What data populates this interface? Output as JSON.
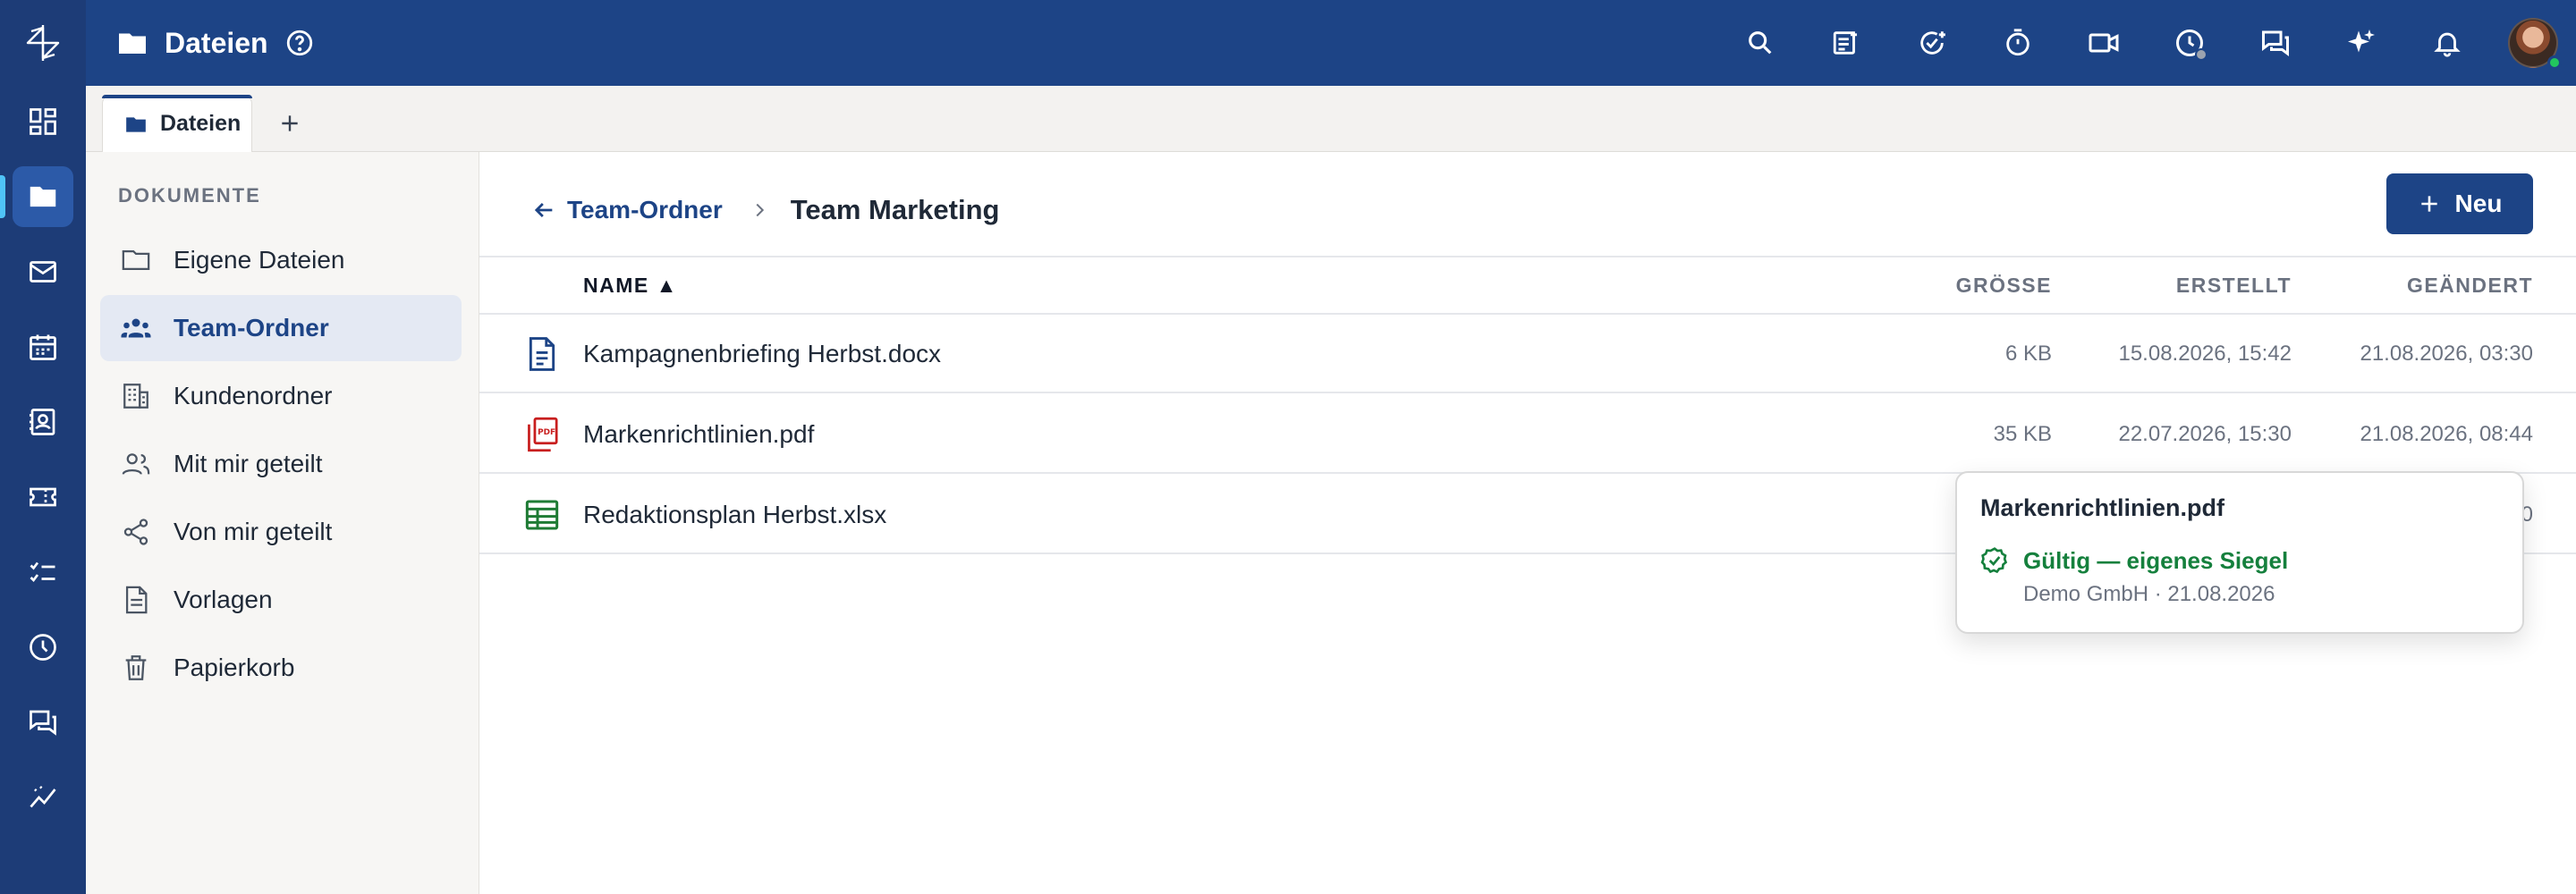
{
  "app": {
    "title": "Dateien"
  },
  "rail": {
    "items": [
      {
        "icon": "dashboard-icon"
      },
      {
        "icon": "folder-icon",
        "active": true
      },
      {
        "icon": "mail-icon"
      },
      {
        "icon": "calendar-icon"
      },
      {
        "icon": "contacts-icon"
      },
      {
        "icon": "ticket-icon"
      },
      {
        "icon": "tasks-icon"
      },
      {
        "icon": "clock-icon"
      },
      {
        "icon": "chat-icon"
      },
      {
        "icon": "analytics-icon"
      }
    ]
  },
  "topbar": {
    "icons": [
      "search-icon",
      "notes-icon",
      "task-add-icon",
      "timer-icon",
      "video-icon",
      "history-icon",
      "chat-icon",
      "ai-sparkle-icon",
      "bell-icon"
    ]
  },
  "tabs": [
    {
      "label": "Dateien"
    }
  ],
  "sidebar": {
    "section_title": "DOKUMENTE",
    "items": [
      {
        "label": "Eigene Dateien",
        "icon": "folder-outline-icon"
      },
      {
        "label": "Team-Ordner",
        "icon": "team-icon",
        "active": true
      },
      {
        "label": "Kundenordner",
        "icon": "building-icon"
      },
      {
        "label": "Mit mir geteilt",
        "icon": "people-icon"
      },
      {
        "label": "Von mir geteilt",
        "icon": "share-icon"
      },
      {
        "label": "Vorlagen",
        "icon": "template-icon"
      },
      {
        "label": "Papierkorb",
        "icon": "trash-icon"
      }
    ]
  },
  "breadcrumb": {
    "parent": "Team-Ordner",
    "current": "Team Marketing"
  },
  "actions": {
    "new_label": "Neu"
  },
  "table": {
    "columns": {
      "name": "NAME ▲",
      "size": "GRÖSSE",
      "created": "ERSTELLT",
      "modified": "GEÄNDERT"
    },
    "rows": [
      {
        "name": "Kampagnenbriefing Herbst.docx",
        "type": "docx",
        "size": "6 KB",
        "created": "15.08.2026, 15:42",
        "modified": "21.08.2026, 03:30"
      },
      {
        "name": "Markenrichtlinien.pdf",
        "type": "pdf",
        "size": "35 KB",
        "created": "22.07.2026, 15:30",
        "modified": "21.08.2026, 08:44"
      },
      {
        "name": "Redaktionsplan Herbst.xlsx",
        "type": "xlsx",
        "size": "",
        "created": "",
        "modified": "0"
      }
    ]
  },
  "tooltip": {
    "title": "Markenrichtlinien.pdf",
    "status": "Gültig — eigenes Siegel",
    "detail": "Demo GmbH · 21.08.2026"
  },
  "colors": {
    "brand": "#1d4486",
    "rail": "#1d3c77",
    "success": "#15803d",
    "pdf": "#c81e1e",
    "xlsx": "#1e7b34"
  }
}
